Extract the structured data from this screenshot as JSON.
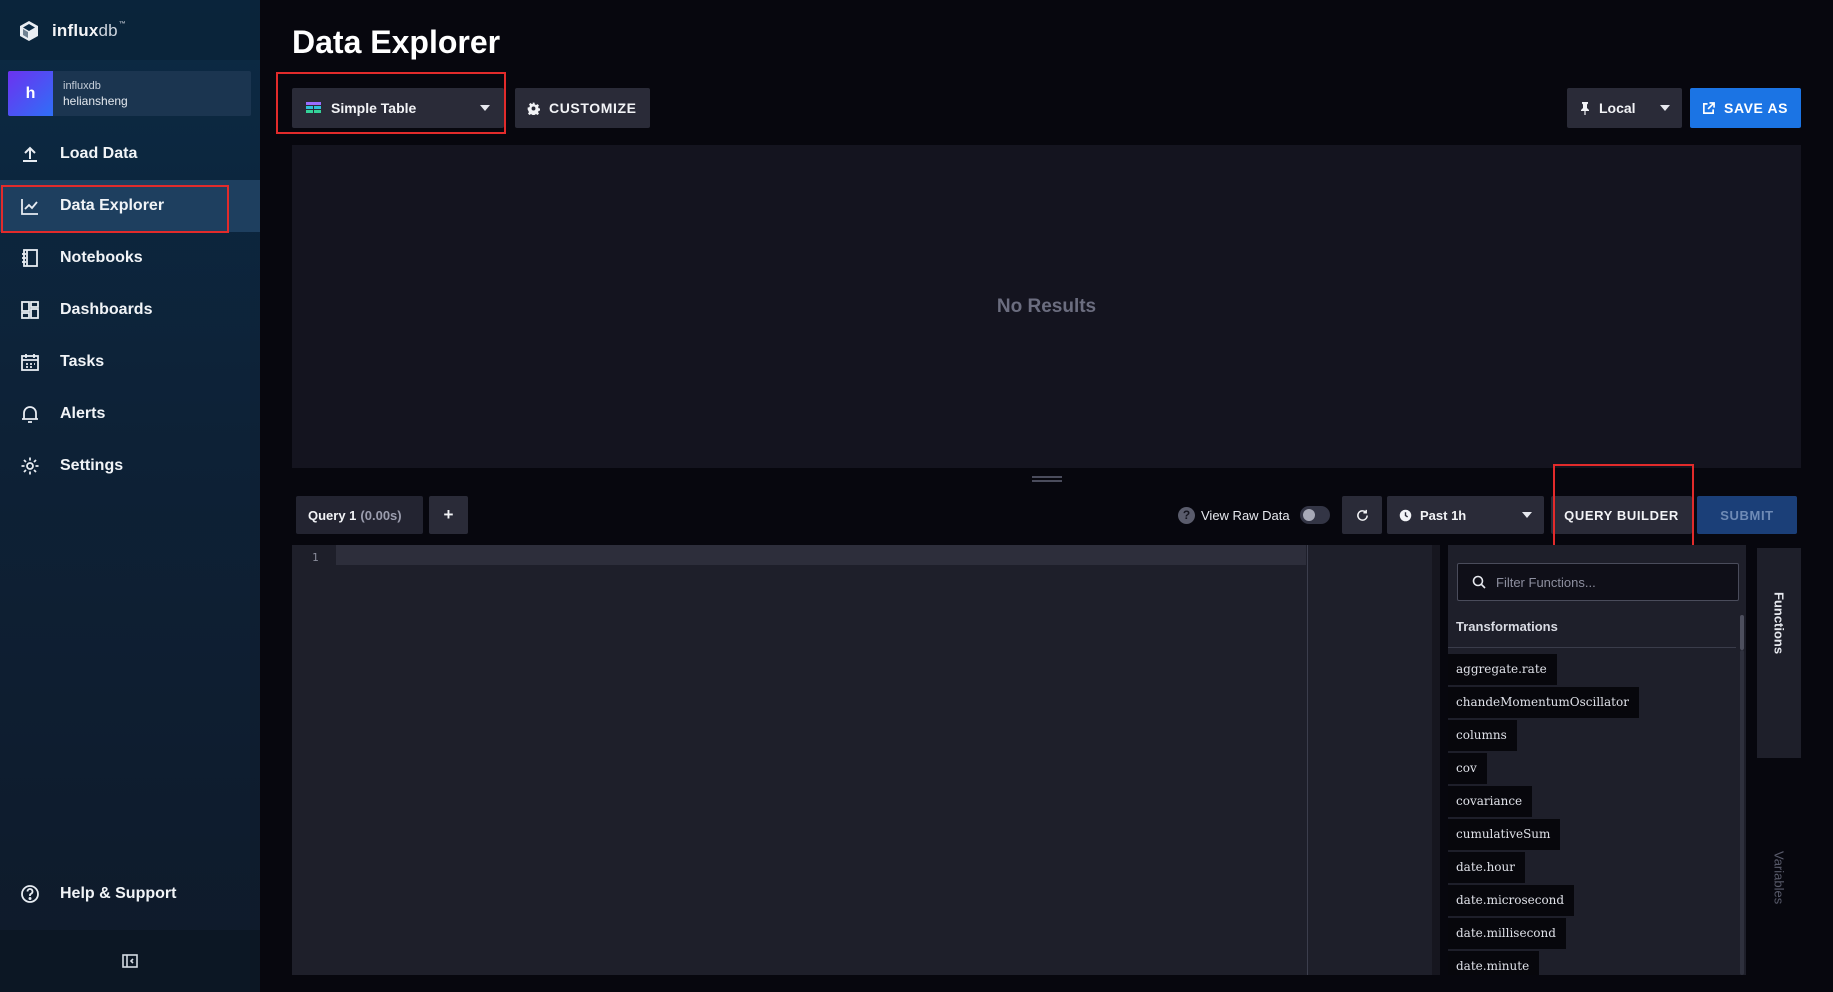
{
  "app": {
    "brand_bold": "influx",
    "brand_light": "db",
    "brand_mark": "™"
  },
  "user": {
    "initial": "h",
    "org": "influxdb",
    "name": "heliansheng"
  },
  "sidebar": {
    "items": [
      {
        "label": "Load Data",
        "icon": "upload-icon"
      },
      {
        "label": "Data Explorer",
        "icon": "chart-line-icon",
        "active": true
      },
      {
        "label": "Notebooks",
        "icon": "notebook-icon"
      },
      {
        "label": "Dashboards",
        "icon": "dashboard-grid-icon"
      },
      {
        "label": "Tasks",
        "icon": "calendar-icon"
      },
      {
        "label": "Alerts",
        "icon": "bell-icon"
      },
      {
        "label": "Settings",
        "icon": "gear-icon"
      }
    ],
    "help_label": "Help & Support"
  },
  "page": {
    "title": "Data Explorer"
  },
  "toolbar": {
    "vis_type": "Simple Table",
    "customize_label": "CUSTOMIZE",
    "timezone": "Local",
    "save_as_label": "SAVE AS"
  },
  "results": {
    "empty_text": "No Results"
  },
  "query_bar": {
    "tab_label": "Query 1",
    "tab_time": "(0.00s)",
    "add_label": "+",
    "raw_data_label": "View Raw Data",
    "raw_data_on": false,
    "time_range": "Past 1h",
    "query_builder_label": "QUERY BUILDER",
    "submit_label": "SUBMIT"
  },
  "editor": {
    "line_number": "1"
  },
  "functions_panel": {
    "search_placeholder": "Filter Functions...",
    "group": "Transformations",
    "items": [
      "aggregate.rate",
      "chandeMomentumOscillator",
      "columns",
      "cov",
      "covariance",
      "cumulativeSum",
      "date.hour",
      "date.microsecond",
      "date.millisecond",
      "date.minute"
    ]
  },
  "side_tabs": {
    "functions": "Functions",
    "variables": "Variables"
  },
  "colors": {
    "accent_blue": "#1b74e4",
    "highlight_red": "#e22b2b",
    "sidebar_active": "#1e3f5f"
  }
}
